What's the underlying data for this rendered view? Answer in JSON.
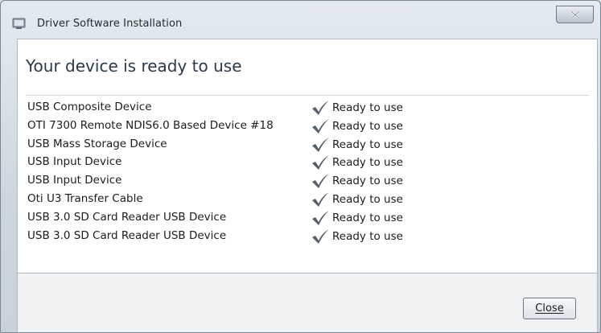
{
  "window": {
    "title": "Driver Software Installation",
    "title_icon": "hardware-device-icon",
    "close_icon": "close-x-icon"
  },
  "content": {
    "heading": "Your device is ready to use",
    "devices": [
      {
        "name": "USB Composite Device",
        "status": "Ready to use"
      },
      {
        "name": "OTI 7300 Remote NDIS6.0 Based Device #18",
        "status": "Ready to use"
      },
      {
        "name": "USB Mass Storage Device",
        "status": "Ready to use"
      },
      {
        "name": "USB Input Device",
        "status": "Ready to use"
      },
      {
        "name": "USB Input Device",
        "status": "Ready to use"
      },
      {
        "name": "Oti U3 Transfer Cable",
        "status": "Ready to use"
      },
      {
        "name": "USB 3.0  SD Card Reader USB Device",
        "status": "Ready to use"
      },
      {
        "name": "USB 3.0  SD Card Reader USB Device",
        "status": "Ready to use"
      }
    ],
    "status_icon": "checkmark-icon"
  },
  "footer": {
    "close_label": "Close"
  },
  "colors": {
    "window_frame": "#cdd6de",
    "content_bg": "#ffffff",
    "check": "#55606b"
  }
}
